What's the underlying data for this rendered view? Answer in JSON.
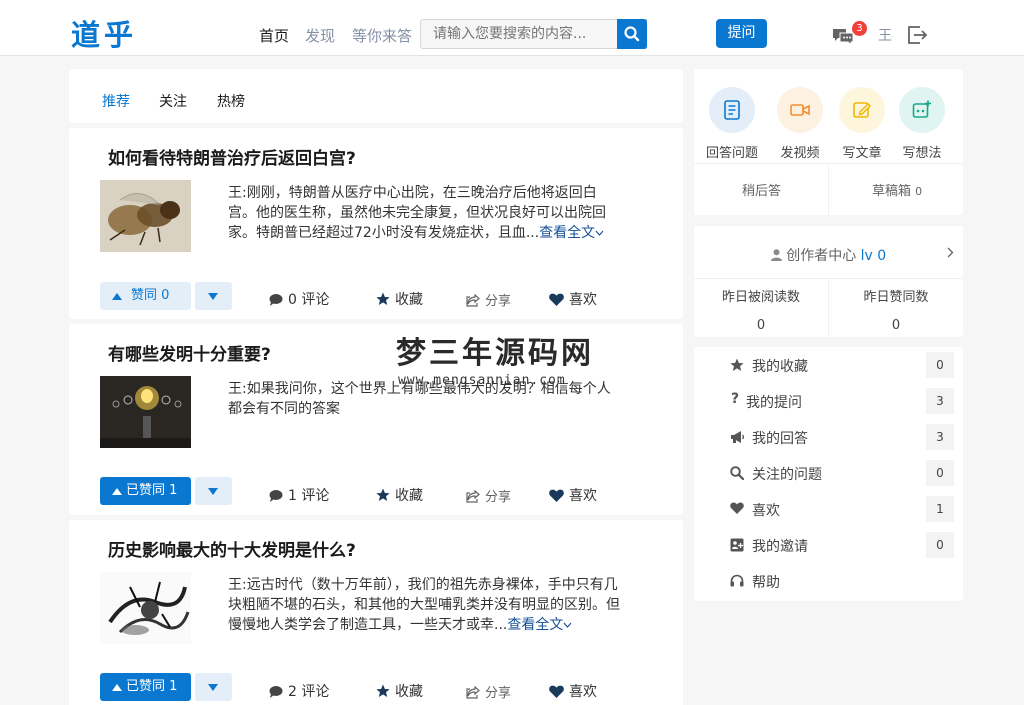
{
  "header": {
    "logo": "道乎",
    "nav": [
      "首页",
      "发现",
      "等你来答"
    ],
    "search_placeholder": "请输入您要搜索的内容...",
    "ask_label": "提问",
    "notification_count": "3",
    "username": "王"
  },
  "tabs": [
    "推荐",
    "关注",
    "热榜"
  ],
  "questions": [
    {
      "title": "如何看待特朗普治疗后返回白宫?",
      "excerpt": "王:刚刚，特朗普从医疗中心出院，在三晚治疗后他将返回白宫。他的医生称，虽然他未完全康复，但状况良好可以出院回家。特朗普已经超过72小时没有发烧症状，且血...",
      "more": "查看全文",
      "vote_label": "赞同 0",
      "comments": "0 评论",
      "collect": "收藏",
      "share": "分享",
      "like": "喜欢"
    },
    {
      "title": "有哪些发明十分重要?",
      "excerpt": "王:如果我问你，这个世界上有哪些最伟大的发明？相信每个人都会有不同的答案",
      "more": "",
      "vote_label": "已赞同 1",
      "comments": "1 评论",
      "collect": "收藏",
      "share": "分享",
      "like": "喜欢"
    },
    {
      "title": "历史影响最大的十大发明是什么?",
      "excerpt": "王:远古时代（数十万年前），我们的祖先赤身裸体，手中只有几块粗陋不堪的石头，和其他的大型哺乳类并没有明显的区别。但慢慢地人类学会了制造工具，一些天才或幸...",
      "more": "查看全文",
      "vote_label": "已赞同 1",
      "comments": "2 评论",
      "collect": "收藏",
      "share": "分享",
      "like": "喜欢"
    }
  ],
  "watermark": {
    "title": "梦三年源码网",
    "url": "www.mengsannian.com"
  },
  "creator": {
    "actions": [
      "回答问题",
      "发视频",
      "写文章",
      "写想法"
    ],
    "later": "稍后答",
    "drafts": "草稿箱",
    "drafts_count": "0"
  },
  "center": {
    "title": "创作者中心",
    "level": "lv 0",
    "stats": [
      {
        "label": "昨日被阅读数",
        "value": "0"
      },
      {
        "label": "昨日赞同数",
        "value": "0"
      }
    ]
  },
  "menu": [
    {
      "label": "我的收藏",
      "count": "0"
    },
    {
      "label": "我的提问",
      "count": "3"
    },
    {
      "label": "我的回答",
      "count": "3"
    },
    {
      "label": "关注的问题",
      "count": "0"
    },
    {
      "label": "喜欢",
      "count": "1"
    },
    {
      "label": "我的邀请",
      "count": "0"
    },
    {
      "label": "帮助",
      "count": ""
    }
  ],
  "colors": {
    "accent": "#0a78d1",
    "badge": "#f1403c"
  }
}
